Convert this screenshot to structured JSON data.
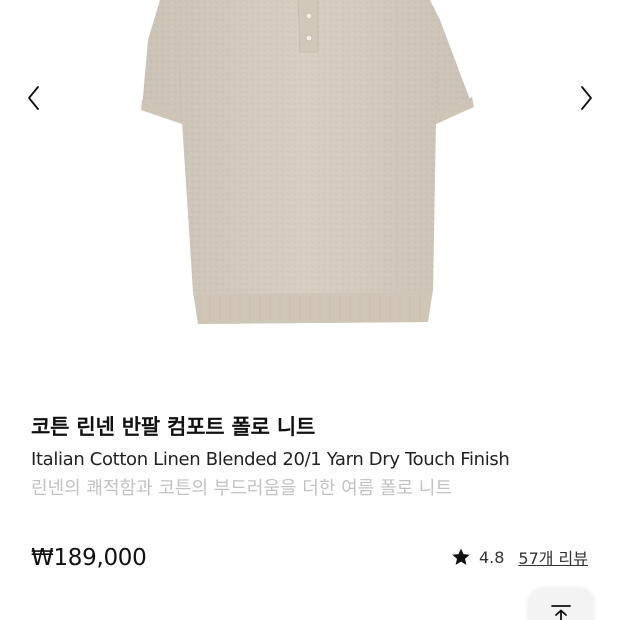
{
  "product": {
    "title_ko": "코튼 린넨 반팔 컴포트 폴로 니트",
    "title_en": "Italian Cotton Linen Blended 20/1 Yarn Dry Touch Finish",
    "subtitle": "린넨의 쾌적함과 코튼의 부드러움을 더한 여름 폴로 니트",
    "price": "₩189,000",
    "rating": "4.8",
    "reviews": "57개 리뷰"
  },
  "colors": {
    "knit": "#d8cfc2",
    "text_primary": "#111111",
    "text_muted": "#c2c2c2"
  },
  "icons": {
    "prev": "chevron-left-icon",
    "next": "chevron-right-icon",
    "rating": "star-icon",
    "scroll_top": "arrow-up-to-top-icon"
  }
}
